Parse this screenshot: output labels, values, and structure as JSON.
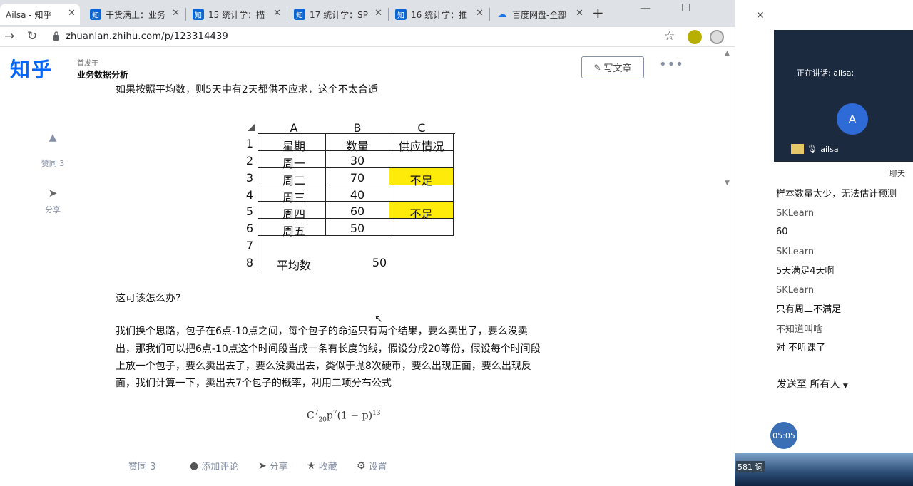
{
  "browser": {
    "tabs": [
      {
        "label": "Ailsa - 知乎",
        "favicon": "",
        "active": true
      },
      {
        "label": "干货满上：业务",
        "favicon": "知"
      },
      {
        "label": "15 统计学：描",
        "favicon": "知"
      },
      {
        "label": "17 统计学：SP",
        "favicon": "知"
      },
      {
        "label": "16 统计学：推",
        "favicon": "知"
      },
      {
        "label": "百度网盘-全部",
        "favicon": "☁"
      }
    ],
    "new_tab": "+",
    "url": "zhuanlan.zhihu.com/p/123314439"
  },
  "header": {
    "logo": "知乎",
    "column_pre": "首发于",
    "column_name": "业务数据分析",
    "write_button": "写文章",
    "write_icon": "✎",
    "more": "•••"
  },
  "article": {
    "cut_line": "如果按照平均数，则5天中有2天都供不应求，这个不太合适",
    "question": "这可该怎么办?",
    "paragraph": [
      "我们换个思路，包子在6点-10点之间，每个包子的命运只有两个结果，要么卖出了，要么没卖",
      "出，那我们可以把6点-10点这个时间段当成一条有长度的线，假设分成20等份，假设每个时间段",
      "上放一个包子，要么卖出去了，要么没卖出去，类似于抛8次硬币，要么出现正面，要么出现反",
      "面，我们计算一下，卖出去7个包子的概率，利用二项分布公式"
    ],
    "formula": {
      "c": "C",
      "c_sub": "20",
      "c_sup": "7",
      "p": "p",
      "p_sup": "7",
      "rest": "(1 − p)",
      "rest_sup": "13"
    }
  },
  "side_actions": {
    "vote_icon": "▲",
    "vote_label": "赞同 3",
    "share_icon": "➤",
    "share_label": "分享"
  },
  "sheet": {
    "col_headers": [
      "A",
      "B",
      "C"
    ],
    "row_numbers": [
      "1",
      "2",
      "3",
      "4",
      "5",
      "6",
      "7",
      "8"
    ],
    "header_row": [
      "星期",
      "数量",
      "供应情况"
    ],
    "rows": [
      {
        "day": "周一",
        "qty": "30",
        "status": ""
      },
      {
        "day": "周二",
        "qty": "70",
        "status": "不足"
      },
      {
        "day": "周三",
        "qty": "40",
        "status": ""
      },
      {
        "day": "周四",
        "qty": "60",
        "status": "不足"
      },
      {
        "day": "周五",
        "qty": "50",
        "status": ""
      }
    ],
    "avg_label": "平均数",
    "avg_value": "50",
    "highlight_color": "#ffeb0a"
  },
  "bottom_bar": {
    "vote": "赞同 3",
    "comment": "添加评论",
    "share": "分享",
    "collect": "收藏",
    "settings": "设置"
  },
  "meeting": {
    "speaking": "正在讲话: ailsa;",
    "avatar_letter": "A",
    "participant": "ailsa",
    "chat_title": "聊天",
    "messages": [
      {
        "sender": "",
        "text": "样本数量太少，无法估计预测"
      },
      {
        "sender": "SKLearn",
        "text": "60"
      },
      {
        "sender": "SKLearn",
        "text": "5天满足4天啊"
      },
      {
        "sender": "SKLearn",
        "text": "只有周二不满足"
      },
      {
        "sender": "不知道叫啥",
        "text": "对 不听课了"
      }
    ],
    "send_to_label": "发送至",
    "send_to_target": "所有人",
    "timer": "05:05",
    "word_count": "581 词"
  }
}
